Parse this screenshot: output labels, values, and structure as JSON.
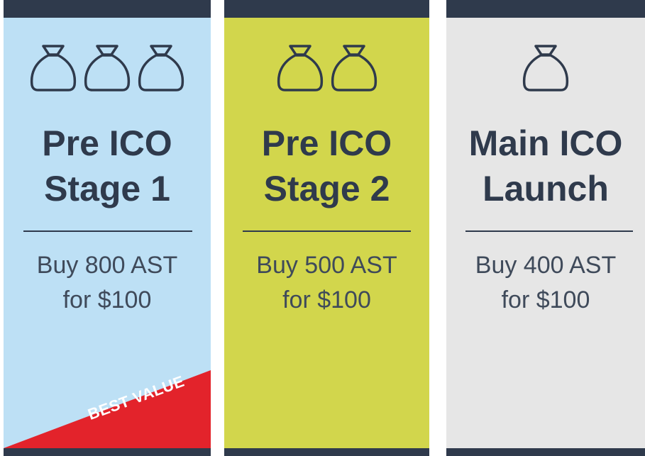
{
  "cards": [
    {
      "bag_count": 3,
      "title_line1": "Pre ICO",
      "title_line2": "Stage 1",
      "price_line1": "Buy 800 AST",
      "price_line2": "for $100",
      "ribbon_label": "BEST VALUE"
    },
    {
      "bag_count": 2,
      "title_line1": "Pre ICO",
      "title_line2": "Stage 2",
      "price_line1": "Buy 500 AST",
      "price_line2": "for $100"
    },
    {
      "bag_count": 1,
      "title_line1": "Main ICO",
      "title_line2": "Launch",
      "price_line1": "Buy 400 AST",
      "price_line2": "for $100"
    }
  ],
  "colors": {
    "dark": "#2f3a4c",
    "card_1_bg": "#bde0f5",
    "card_2_bg": "#d2d64c",
    "card_3_bg": "#e6e6e6",
    "ribbon": "#e3232b"
  },
  "icons": {
    "bag": "money-bag-icon"
  }
}
